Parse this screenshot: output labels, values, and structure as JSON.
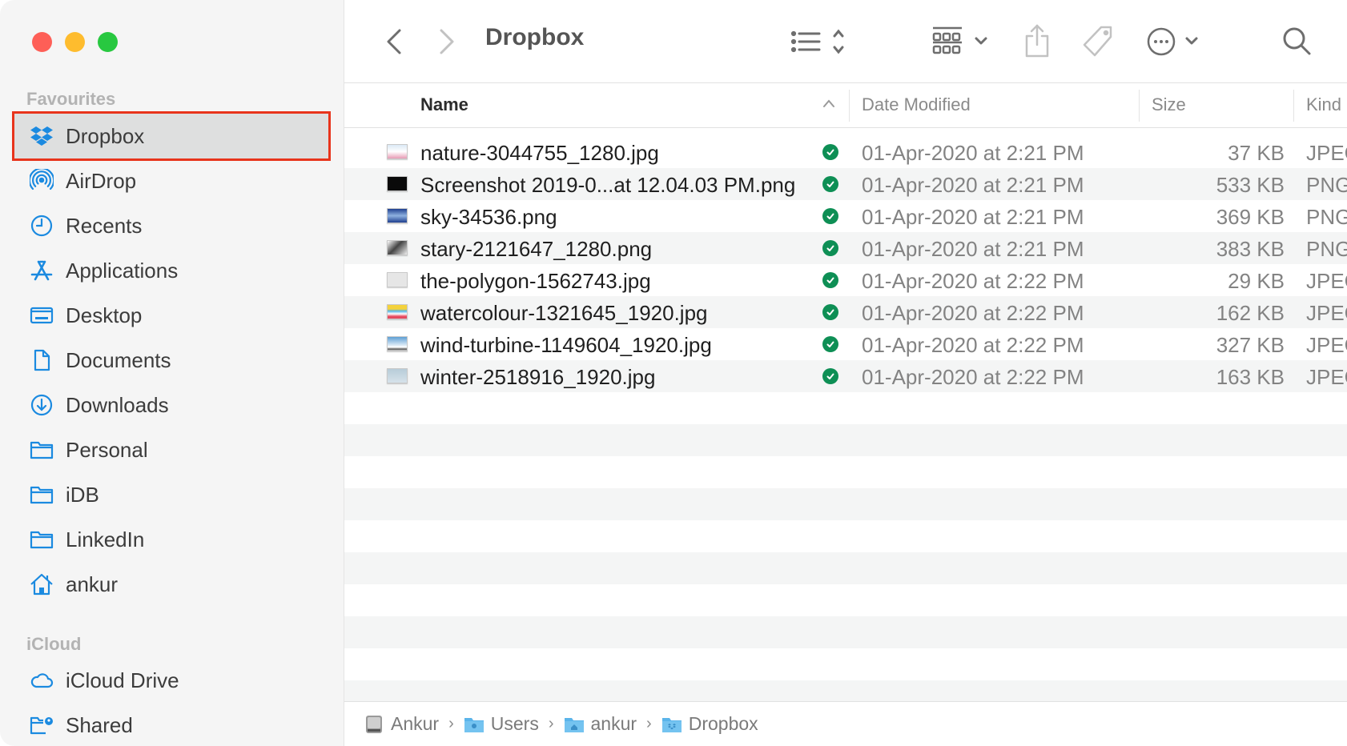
{
  "window": {
    "title": "Dropbox",
    "traffic_lights": {
      "close": "#fe5f57",
      "minimize": "#febc2e",
      "zoom": "#28c840"
    }
  },
  "sidebar": {
    "sections": [
      {
        "label": "Favourites"
      },
      {
        "label": "iCloud"
      }
    ],
    "favourites": [
      {
        "label": "Dropbox",
        "icon": "dropbox-icon",
        "selected": true
      },
      {
        "label": "AirDrop",
        "icon": "airdrop-icon"
      },
      {
        "label": "Recents",
        "icon": "clock-icon"
      },
      {
        "label": "Applications",
        "icon": "applications-icon"
      },
      {
        "label": "Desktop",
        "icon": "desktop-icon"
      },
      {
        "label": "Documents",
        "icon": "document-icon"
      },
      {
        "label": "Downloads",
        "icon": "download-icon"
      },
      {
        "label": "Personal",
        "icon": "folder-icon"
      },
      {
        "label": "iDB",
        "icon": "folder-icon"
      },
      {
        "label": "LinkedIn",
        "icon": "folder-icon"
      },
      {
        "label": "ankur",
        "icon": "home-icon"
      }
    ],
    "icloud": [
      {
        "label": "iCloud Drive",
        "icon": "cloud-icon"
      },
      {
        "label": "Shared",
        "icon": "shared-folder-icon"
      }
    ],
    "accent_color": "#1b8ae0",
    "highlight_color": "#e8341c"
  },
  "toolbar": {
    "back": "chevron-left-icon",
    "forward": "chevron-right-icon",
    "view_mode": "list-view-icon",
    "group": "grid-group-icon",
    "share": "share-icon",
    "tag": "tag-icon",
    "more": "ellipsis-circle-icon",
    "search": "search-icon"
  },
  "table": {
    "columns": {
      "name": "Name",
      "date": "Date Modified",
      "size": "Size",
      "kind": "Kind"
    },
    "sort": {
      "column": "Name",
      "direction": "ascending"
    },
    "rows": [
      {
        "name": "nature-3044755_1280.jpg",
        "date": "01-Apr-2020 at 2:21 PM",
        "size": "37 KB",
        "kind": "JPEG",
        "thumb": "nature"
      },
      {
        "name": "Screenshot 2019-0...at 12.04.03 PM.png",
        "date": "01-Apr-2020 at 2:21 PM",
        "size": "533 KB",
        "kind": "PNG",
        "thumb": "screenshot"
      },
      {
        "name": "sky-34536.png",
        "date": "01-Apr-2020 at 2:21 PM",
        "size": "369 KB",
        "kind": "PNG",
        "thumb": "sky"
      },
      {
        "name": "stary-2121647_1280.png",
        "date": "01-Apr-2020 at 2:21 PM",
        "size": "383 KB",
        "kind": "PNG",
        "thumb": "stary"
      },
      {
        "name": "the-polygon-1562743.jpg",
        "date": "01-Apr-2020 at 2:22 PM",
        "size": "29 KB",
        "kind": "JPEG",
        "thumb": "polygon"
      },
      {
        "name": "watercolour-1321645_1920.jpg",
        "date": "01-Apr-2020 at 2:22 PM",
        "size": "162 KB",
        "kind": "JPEG",
        "thumb": "watercolour"
      },
      {
        "name": "wind-turbine-1149604_1920.jpg",
        "date": "01-Apr-2020 at 2:22 PM",
        "size": "327 KB",
        "kind": "JPEG",
        "thumb": "wind"
      },
      {
        "name": "winter-2518916_1920.jpg",
        "date": "01-Apr-2020 at 2:22 PM",
        "size": "163 KB",
        "kind": "JPEG",
        "thumb": "winter"
      }
    ],
    "sync_status": "synced",
    "sync_color": "#0e8f55"
  },
  "pathbar": {
    "crumbs": [
      {
        "label": "Ankur",
        "icon": "hard-drive-icon"
      },
      {
        "label": "Users",
        "icon": "users-folder-icon"
      },
      {
        "label": "ankur",
        "icon": "home-folder-icon"
      },
      {
        "label": "Dropbox",
        "icon": "dropbox-folder-icon"
      }
    ]
  }
}
